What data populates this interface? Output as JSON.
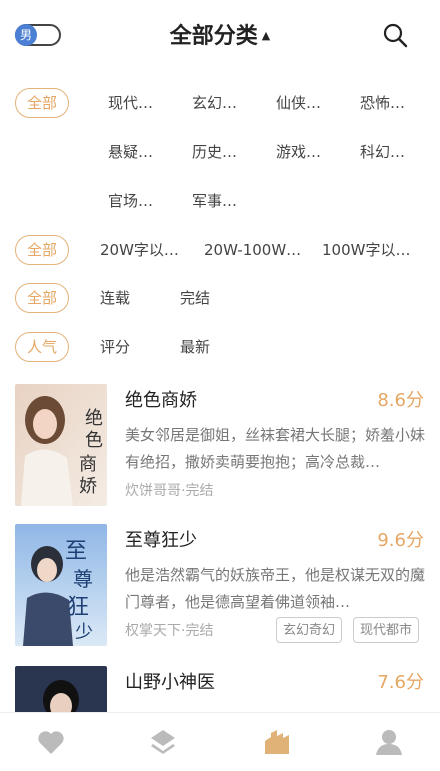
{
  "header": {
    "gender_label": "男",
    "title": "全部分类"
  },
  "filters": {
    "category": {
      "pill": "全部",
      "items": [
        "现代…",
        "玄幻…",
        "仙侠…",
        "恐怖…",
        "悬疑…",
        "历史…",
        "游戏…",
        "科幻…",
        "官场…",
        "军事…"
      ]
    },
    "length": {
      "pill": "全部",
      "items": [
        "20W字以…",
        "20W-100W…",
        "100W字以…"
      ]
    },
    "status": {
      "pill": "全部",
      "items": [
        "连载",
        "完结"
      ]
    },
    "sort": {
      "pill": "人气",
      "items": [
        "评分",
        "最新"
      ]
    }
  },
  "books": [
    {
      "title": "绝色商娇",
      "score": "8.6分",
      "desc": "美女邻居是御姐，丝袜套裙大长腿；娇羞小妹有绝招，撒娇卖萌要抱抱；高冷总裁…",
      "author": "炊饼哥哥·完结",
      "tags": [],
      "cover_text": "绝色商娇"
    },
    {
      "title": "至尊狂少",
      "score": "9.6分",
      "desc": "他是浩然霸气的妖族帝王，他是权谋无双的魔门尊者，他是德高望着佛道领袖…",
      "author": "权掌天下·完结",
      "tags": [
        "玄幻奇幻",
        "现代都市"
      ],
      "cover_text": "至尊狂少"
    },
    {
      "title": "山野小神医",
      "score": "7.6分",
      "desc": "",
      "author": "",
      "tags": [],
      "cover_text": ""
    }
  ],
  "tabs": [
    "favorites-icon",
    "layers-icon",
    "category-icon",
    "profile-icon"
  ],
  "colors": {
    "accent": "#e5a763",
    "toggle": "#4a7fd4",
    "tab_active": "#e0b277",
    "tab_inactive": "#bbbbbb"
  }
}
